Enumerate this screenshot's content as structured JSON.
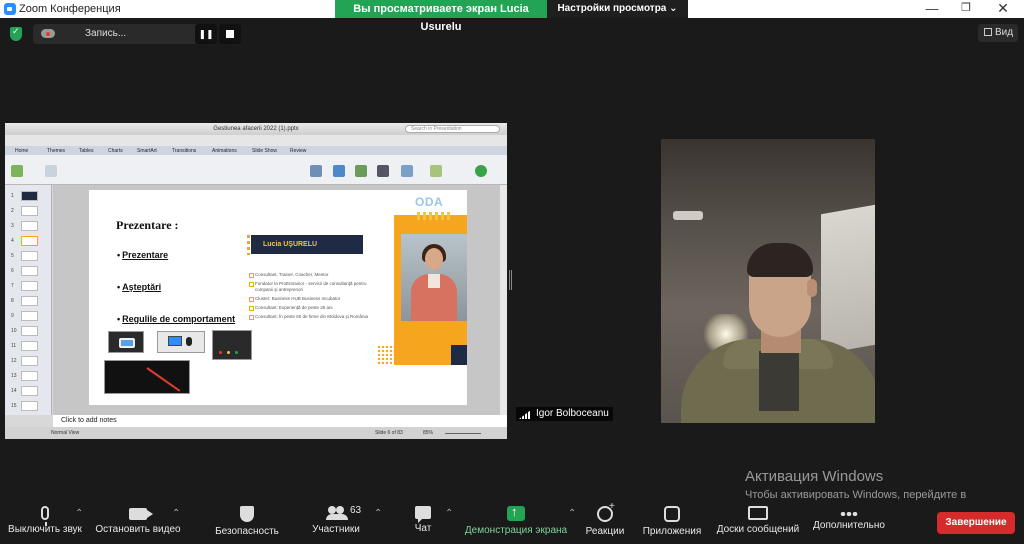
{
  "window": {
    "title": "Zoom Конференция",
    "share_banner": "Вы просматриваете экран Lucia Usurelu",
    "view_settings": "Настройки просмотра",
    "view_settings_icon": "chevron-down-icon",
    "minimize": "—",
    "maximize": "❐",
    "close": "✕"
  },
  "meeting_bar": {
    "recording_label": "Запись...",
    "pause": "❚❚",
    "view_label": "Вид"
  },
  "powerpoint": {
    "file_title": "Gestiunea afacerii 2022 (1).pptx",
    "search_placeholder": "Search in Presentation",
    "ribbon_tabs": [
      "Home",
      "Themes",
      "Tables",
      "Charts",
      "SmartArt",
      "Transitions",
      "Animations",
      "Slide Show",
      "Review"
    ],
    "slide_numbers": [
      "1",
      "2",
      "3",
      "4",
      "5",
      "6",
      "7",
      "8",
      "9",
      "10",
      "11",
      "12",
      "13",
      "14",
      "15"
    ],
    "notes_placeholder": "Click to add notes",
    "status_view": "Normal View",
    "status_slide": "Slide 6 of 83",
    "status_zoom": "85%"
  },
  "slide": {
    "title": "Prezentare :",
    "bullets": [
      "Prezentare",
      "Aşteptări",
      "Regulile de comportament"
    ],
    "name_box": "Lucia UŞURELU",
    "logo": "ODA",
    "info_lines": [
      "Consultant, Trainer, Coacher, Mentor",
      "Fondator la ProEntrainor - servicii de consultanţă pentru companii şi antreprenori",
      "Cluster: Business HUB Business Incubator",
      "Consultant: Experienţă de peste 25 ani",
      "Consultant: În peste 60 de firme din Moldova şi România"
    ]
  },
  "participant": {
    "name": "Igor Bolboceanu"
  },
  "activation": {
    "title": "Активация Windows",
    "text": "Чтобы активировать Windows, перейдите в раздел \"Параметры\"."
  },
  "toolbar": {
    "mute": "Выключить звук",
    "video": "Остановить видео",
    "security": "Безопасность",
    "participants": "Участники",
    "participants_count": "63",
    "chat": "Чат",
    "share": "Демонстрация экрана",
    "reactions": "Реакции",
    "apps": "Приложения",
    "whiteboards": "Доски сообщений",
    "more": "Дополнительно",
    "end": "Завершение"
  },
  "colors": {
    "share_banner": "#23a455",
    "end_button": "#d62b2b",
    "toolbar_bg": "#1a1a1a"
  }
}
